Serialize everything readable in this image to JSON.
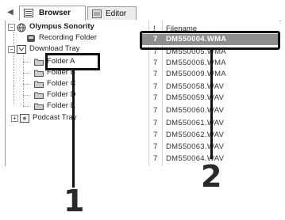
{
  "tabs": [
    {
      "label": "Browser",
      "icon": "browser-icon",
      "active": true
    },
    {
      "label": "Editor",
      "icon": "editor-icon",
      "active": false
    }
  ],
  "tree": {
    "root": {
      "label": "Olympus Sonority",
      "icon": "globe-icon"
    },
    "recording_folder": {
      "label": "Recording Folder",
      "icon": "recorder-icon"
    },
    "download_tray": {
      "label": "Download Tray",
      "icon": "tray-icon"
    },
    "folders": [
      {
        "label": "Folder A",
        "icon": "folder-icon"
      },
      {
        "label": "Folder B",
        "icon": "folder-icon"
      },
      {
        "label": "Folder C",
        "icon": "folder-icon"
      },
      {
        "label": "Folder D",
        "icon": "folder-icon"
      },
      {
        "label": "Folder E",
        "icon": "folder-icon"
      }
    ],
    "podcast_tray": {
      "label": "Podcast Tray",
      "icon": "podcast-icon"
    }
  },
  "file_list": {
    "headers": {
      "flag": "!",
      "filename": "Filename"
    },
    "rows": [
      {
        "num": "7",
        "name": "DM550004.WMA",
        "selected": true
      },
      {
        "num": "7",
        "name": "DM550005.WMA",
        "selected": false
      },
      {
        "num": "7",
        "name": "DM550006.WMA",
        "selected": false
      },
      {
        "num": "7",
        "name": "DM550009.WMA",
        "selected": false
      },
      {
        "num": "7",
        "name": "DM550058.WAV",
        "selected": false
      },
      {
        "num": "7",
        "name": "DM550059.WAV",
        "selected": false
      },
      {
        "num": "7",
        "name": "DM550060.WAV",
        "selected": false
      },
      {
        "num": "7",
        "name": "DM550061.WAV",
        "selected": false
      },
      {
        "num": "7",
        "name": "DM550062.WAV",
        "selected": false
      },
      {
        "num": "7",
        "name": "DM550063.WAV",
        "selected": false
      },
      {
        "num": "7",
        "name": "DM550064.WAV",
        "selected": false
      }
    ]
  },
  "callouts": {
    "one": "1",
    "two": "2"
  }
}
